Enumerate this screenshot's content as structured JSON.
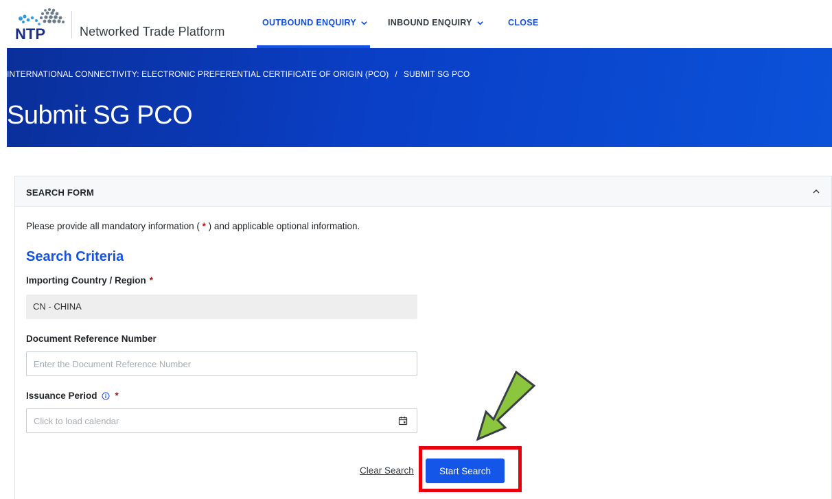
{
  "nav": {
    "brand": "Networked Trade Platform",
    "links": [
      {
        "label": "OUTBOUND ENQUIRY",
        "active": true
      },
      {
        "label": "INBOUND ENQUIRY",
        "active": false
      },
      {
        "label": "CLOSE",
        "active": false
      }
    ]
  },
  "banner": {
    "breadcrumb": [
      "INTERNATIONAL CONNECTIVITY: ELECTRONIC PREFERENTIAL CERTIFICATE OF ORIGIN (PCO)",
      "SUBMIT SG PCO"
    ],
    "breadcrumb_separator": "/",
    "title": "Submit SG PCO"
  },
  "form": {
    "header": "SEARCH FORM",
    "intro_before": "Please provide all mandatory information (",
    "intro_star": "*",
    "intro_after": ") and applicable optional information.",
    "section_title": "Search Criteria",
    "required_marker": "*",
    "fields": {
      "country": {
        "label": "Importing Country / Region",
        "value": "CN - CHINA"
      },
      "docref": {
        "label": "Document Reference Number",
        "placeholder": "Enter the Document Reference Number",
        "value": ""
      },
      "period": {
        "label": "Issuance Period",
        "placeholder": "Click to load calendar",
        "value": ""
      }
    },
    "clear_label": "Clear Search",
    "start_label": "Start Search"
  },
  "colors": {
    "primary": "#1452e3",
    "banner_dark": "#0a2f9a",
    "required": "#b0121b",
    "highlight_red": "#e8000b",
    "arrow_green": "#8cc63f"
  },
  "icons": {
    "nav_dropdown": "chevron-down-icon",
    "collapse": "chevron-up-icon",
    "info": "info-circle-icon",
    "calendar": "calendar-icon",
    "annotation_arrow": "arrow-down-left-icon"
  }
}
